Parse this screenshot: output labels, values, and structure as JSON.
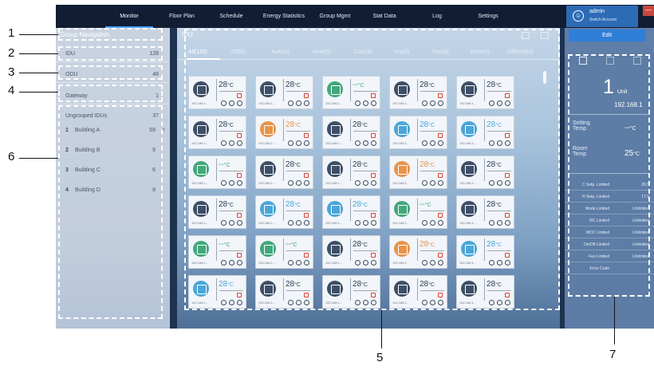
{
  "nav": [
    "Monitor",
    "Floor Plan",
    "Schedule",
    "Energy Statistics",
    "Group Mgmt",
    "Stat Data",
    "Log",
    "Settings"
  ],
  "user": {
    "name": "admin",
    "switch": "Switch Account",
    "close": "—"
  },
  "left": {
    "title": "Group Navigation",
    "rows": [
      {
        "k": "IDU",
        "v": "128"
      },
      {
        "k": "ODU",
        "v": "48"
      },
      {
        "k": "Gateway",
        "v": "1"
      }
    ],
    "ungrouped": {
      "k": "Ungrouped IDUs",
      "v": "37"
    },
    "buildings": [
      {
        "n": "1",
        "k": "Building A",
        "v": "59",
        "a": "»"
      },
      {
        "n": "2",
        "k": "Building B",
        "v": "9",
        "a": ""
      },
      {
        "n": "3",
        "k": "Building C",
        "v": "6",
        "a": ""
      },
      {
        "n": "4",
        "k": "Building D",
        "v": "8",
        "a": ""
      }
    ]
  },
  "center": {
    "title": "IDU",
    "tabs": [
      "All(128)",
      "Off(0)",
      "Auto(4)",
      "Heat(5)",
      "Cool(8)",
      "Dry(0)",
      "Fan(5)",
      "Error(0)",
      "Offline(64)"
    ],
    "ip": "192.168.1...",
    "unit": "°C",
    "cards": [
      [
        "28",
        "28",
        "--",
        "28",
        "28"
      ],
      [
        "28",
        "28",
        "28",
        "28",
        "28"
      ],
      [
        "--",
        "28",
        "28",
        "28",
        "28"
      ],
      [
        "28",
        "28",
        "28",
        "--",
        "28"
      ],
      [
        "--",
        "--",
        "28",
        "28",
        "28"
      ],
      [
        "28",
        "28",
        "28",
        "28",
        "28"
      ]
    ],
    "colors": [
      [
        "dark",
        "dark",
        "green",
        "dark",
        "dark"
      ],
      [
        "dark",
        "orange",
        "dark",
        "blue",
        "blue"
      ],
      [
        "green",
        "dark",
        "dark",
        "orange",
        "dark"
      ],
      [
        "dark",
        "blue",
        "blue",
        "green",
        "dark"
      ],
      [
        "green",
        "green",
        "dark",
        "orange",
        "blue"
      ],
      [
        "blue",
        "dark",
        "dark",
        "dark",
        "dark"
      ]
    ]
  },
  "right": {
    "edit": "Edit",
    "unit_num": "1",
    "unit_label": "Unit",
    "ip": "192.168.1",
    "setting_label": "Setting\nTemp",
    "setting_val": "--",
    "room_label": "Room\nTemp",
    "room_val": "25",
    "deg": "°C",
    "limits": [
      {
        "k": "C Setp. Limited",
        "v": "26.5"
      },
      {
        "k": "H Setp. Limited",
        "v": "17.5"
      },
      {
        "k": "Mode Limited",
        "v": "Unlimited"
      },
      {
        "k": "RC Limited",
        "v": "Unlimited"
      },
      {
        "k": "WDC Limited",
        "v": "Unlimited"
      },
      {
        "k": "On/Off Limited",
        "v": "Unlimited"
      },
      {
        "k": "Fan Limited",
        "v": "Unlimited"
      },
      {
        "k": "Error Code",
        "v": ""
      }
    ]
  },
  "callouts": [
    "1",
    "2",
    "3",
    "4",
    "5",
    "6",
    "7"
  ],
  "palette": {
    "dark": "#3d4f66",
    "green": "#43a77c",
    "orange": "#e8944a",
    "blue": "#4aa6d8"
  }
}
